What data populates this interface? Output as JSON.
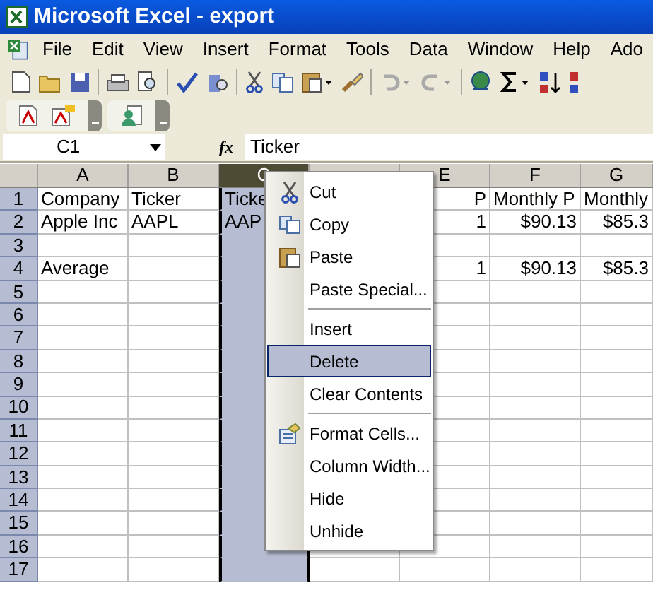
{
  "window": {
    "title": "Microsoft Excel - export"
  },
  "menu_bar": [
    "File",
    "Edit",
    "View",
    "Insert",
    "Format",
    "Tools",
    "Data",
    "Window",
    "Help",
    "Ado"
  ],
  "formula_bar": {
    "name_box": "C1",
    "fx": "fx",
    "value": "Ticker"
  },
  "columns": [
    {
      "label": "A",
      "selected": false
    },
    {
      "label": "B",
      "selected": false
    },
    {
      "label": "C",
      "selected": true
    },
    {
      "selected": false
    },
    {
      "label": "E",
      "selected": false
    },
    {
      "label": "F",
      "selected": false
    },
    {
      "label": "G",
      "selected": false
    }
  ],
  "rows": [
    {
      "header": "1",
      "cells": [
        {
          "text": "Company",
          "kind": "text"
        },
        {
          "text": "Ticker",
          "kind": "text"
        },
        {
          "text": "Ticke",
          "kind": "text"
        },
        null,
        {
          "text": "P",
          "kind": "number"
        },
        {
          "text": "Monthly P",
          "kind": "text"
        },
        {
          "text": "Monthly",
          "kind": "text"
        }
      ]
    },
    {
      "header": "2",
      "cells": [
        {
          "text": "Apple Inc",
          "kind": "text"
        },
        {
          "text": "AAPL",
          "kind": "text"
        },
        {
          "text": "AAP",
          "kind": "text"
        },
        null,
        {
          "text": "1",
          "kind": "number"
        },
        {
          "text": "$90.13",
          "kind": "number"
        },
        {
          "text": "$85.3",
          "kind": "number"
        }
      ]
    },
    {
      "header": "3",
      "cells": []
    },
    {
      "header": "4",
      "cells": [
        {
          "text": "Average",
          "kind": "text"
        },
        null,
        null,
        null,
        {
          "text": "1",
          "kind": "number"
        },
        {
          "text": "$90.13",
          "kind": "number"
        },
        {
          "text": "$85.3",
          "kind": "number"
        }
      ]
    },
    {
      "header": "5",
      "cells": []
    },
    {
      "header": "6",
      "cells": []
    },
    {
      "header": "7",
      "cells": []
    },
    {
      "header": "8",
      "cells": []
    },
    {
      "header": "9",
      "cells": []
    },
    {
      "header": "10",
      "cells": []
    },
    {
      "header": "11",
      "cells": []
    },
    {
      "header": "12",
      "cells": []
    },
    {
      "header": "13",
      "cells": []
    },
    {
      "header": "14",
      "cells": []
    },
    {
      "header": "15",
      "cells": []
    },
    {
      "header": "16",
      "cells": []
    },
    {
      "header": "17",
      "cells": []
    }
  ],
  "context_menu": [
    {
      "kind": "item",
      "label": "Cut",
      "selected": false
    },
    {
      "kind": "item",
      "label": "Copy",
      "selected": false
    },
    {
      "kind": "item",
      "label": "Paste",
      "selected": false
    },
    {
      "kind": "item",
      "label": "Paste Special...",
      "selected": false
    },
    {
      "kind": "separator"
    },
    {
      "kind": "item",
      "label": "Insert",
      "selected": false
    },
    {
      "kind": "item",
      "label": "Delete",
      "selected": true
    },
    {
      "kind": "item",
      "label": "Clear Contents",
      "selected": false
    },
    {
      "kind": "separator"
    },
    {
      "kind": "item",
      "label": "Format Cells...",
      "selected": false
    },
    {
      "kind": "item",
      "label": "Column Width...",
      "selected": false
    },
    {
      "kind": "item",
      "label": "Hide",
      "selected": false
    },
    {
      "kind": "item",
      "label": "Unhide",
      "selected": false
    }
  ]
}
